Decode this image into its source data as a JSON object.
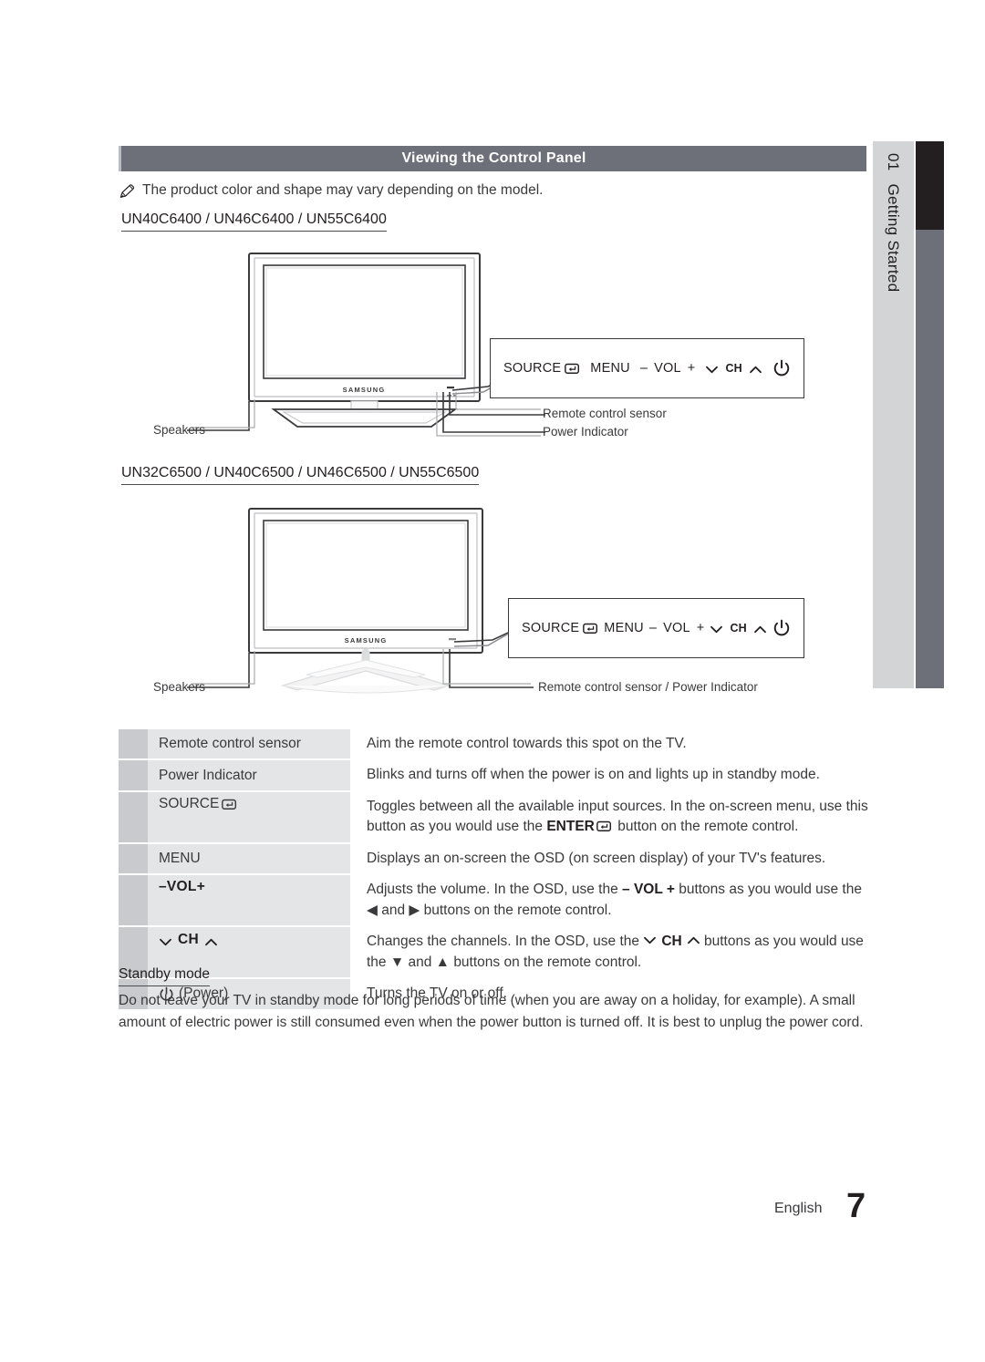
{
  "chapter_tab": {
    "number": "01",
    "name": "Getting Started"
  },
  "header": {
    "title": "Viewing the Control Panel"
  },
  "note": {
    "icon": "pencil-note-icon",
    "text": "The product color and shape may vary depending on the model."
  },
  "sections": [
    {
      "models": "UN40C6400 / UN46C6400 / UN55C6400",
      "callouts": {
        "speakers": "Speakers",
        "remote_sensor": "Remote control sensor",
        "power_indicator": "Power Indicator"
      },
      "control_panel": {
        "source": "SOURCE",
        "source_icon": "enter-icon",
        "menu": "MENU",
        "vol_minus": "–",
        "vol": "VOL",
        "vol_plus": "+",
        "ch_down_icon": "chevron-down-icon",
        "ch": "CH",
        "ch_up_icon": "chevron-up-icon",
        "power_icon": "power-icon"
      },
      "tv_logo": "SAMSUNG"
    },
    {
      "models": "UN32C6500 / UN40C6500 / UN46C6500 / UN55C6500",
      "callouts": {
        "speakers": "Speakers",
        "remote_sensor_power": "Remote control sensor / Power Indicator"
      },
      "control_panel": {
        "source": "SOURCE",
        "source_icon": "enter-icon",
        "menu": "MENU",
        "vol_minus": "–",
        "vol": "VOL",
        "vol_plus": "+",
        "ch_down_icon": "chevron-down-icon",
        "ch": "CH",
        "ch_up_icon": "chevron-up-icon",
        "power_icon": "power-icon"
      },
      "tv_logo": "SAMSUNG"
    }
  ],
  "table": {
    "rows": [
      {
        "key": "Remote control sensor",
        "key_style": "plain",
        "desc_pre": "Aim the remote control towards this spot on the TV.",
        "desc_post": ""
      },
      {
        "key": "Power Indicator",
        "key_style": "plain",
        "desc_pre": "Blinks and turns off when the power is on and lights up in standby mode.",
        "desc_post": ""
      },
      {
        "key": "SOURCE",
        "key_style": "plain-icon",
        "desc_pre": "Toggles between all the available input sources. In the on-screen menu, use this button as you would use the ",
        "desc_mid": "ENTER",
        "desc_post": " button on the remote control."
      },
      {
        "key": "MENU",
        "key_style": "plain",
        "desc_pre": "Displays an on-screen the OSD (on screen display) of your TV's features.",
        "desc_post": ""
      },
      {
        "key": "VOL",
        "key_style": "vol",
        "desc_pre": "Adjusts the volume. In the OSD, use the ",
        "desc_mid": "– VOL +",
        "desc_post": " buttons as you would use the ◀ and ▶ buttons on the remote control."
      },
      {
        "key": "CH",
        "key_style": "ch",
        "desc_pre": "Changes the channels. In the OSD, use the ",
        "desc_mid": "CH",
        "desc_post": " buttons as you would use the ▼ and ▲ buttons on the remote control."
      },
      {
        "key": "(Power)",
        "key_style": "power",
        "desc_pre": "Turns the TV on or off.",
        "desc_post": ""
      }
    ]
  },
  "standby": {
    "heading": "Standby mode",
    "body": "Do not leave your TV in standby mode for long periods of time (when you are away on a holiday, for example). A small amount of electric power is still consumed even when the power button is turned off. It is best to unplug the power cord."
  },
  "footer": {
    "language": "English",
    "page": "7"
  },
  "colors": {
    "header_bar": "#6d7078",
    "tab_light": "#d3d4d6",
    "tab_dark": "#231f20",
    "row_strip": "#c9cacd",
    "row_key": "#e4e5e7"
  }
}
